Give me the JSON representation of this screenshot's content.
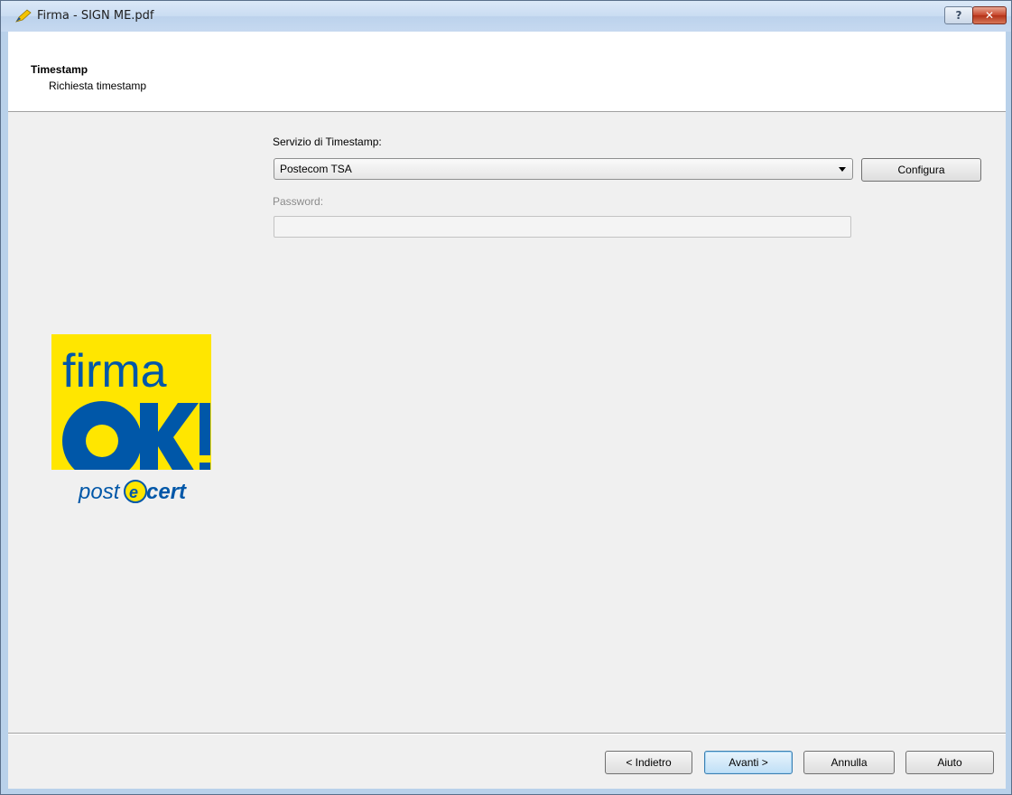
{
  "window": {
    "title": "Firma - SIGN ME.pdf",
    "help_label": "?",
    "close_label": "✕"
  },
  "header": {
    "title": "Timestamp",
    "subtitle": "Richiesta timestamp"
  },
  "logo": {
    "alt": "firma OK! postecert",
    "word_top": "firma",
    "word_main": "OK!",
    "word_brand": "post@cert",
    "colors": {
      "yellow": "#ffe600",
      "blue": "#0057a8"
    }
  },
  "form": {
    "service_label": "Servizio di Timestamp:",
    "service_value": "Postecom TSA",
    "configure_label": "Configura",
    "password_label": "Password:",
    "password_value": ""
  },
  "footer": {
    "back_label": "< Indietro",
    "next_label": "Avanti >",
    "cancel_label": "Annulla",
    "help_label": "Aiuto"
  }
}
